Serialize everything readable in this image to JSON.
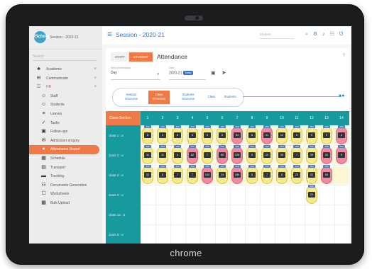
{
  "device": {
    "brand": "chrome"
  },
  "sidebar": {
    "logo": "iSchool",
    "session": "Session - 2020-21",
    "search_placeholder": "Search",
    "items": [
      {
        "label": "Academic",
        "icon": "cap-icon",
        "glyph": "♣",
        "chev": "˅"
      },
      {
        "label": "Communicate",
        "icon": "message-icon",
        "glyph": "✉",
        "chev": "˅"
      },
      {
        "label": "HR",
        "icon": "hr-icon",
        "glyph": "☰",
        "chev": "˄"
      },
      {
        "label": "Staff",
        "icon": "staff-icon",
        "glyph": "☺"
      },
      {
        "label": "Students",
        "icon": "students-icon",
        "glyph": "☺"
      },
      {
        "label": "Leaves",
        "icon": "leaves-icon",
        "glyph": "≡"
      },
      {
        "label": "Tasks",
        "icon": "tasks-icon",
        "glyph": "✓"
      },
      {
        "label": "Follow-ups",
        "icon": "followups-icon",
        "glyph": "▣"
      },
      {
        "label": "Admission enquiry",
        "icon": "enquiry-icon",
        "glyph": "✉"
      },
      {
        "label": "Attendance Report",
        "icon": "attendance-icon",
        "glyph": "●"
      },
      {
        "label": "Schedule",
        "icon": "schedule-icon",
        "glyph": "▦"
      },
      {
        "label": "Transport",
        "icon": "transport-icon",
        "glyph": "▤"
      },
      {
        "label": "Tracking",
        "icon": "tracking-icon",
        "glyph": "▬"
      },
      {
        "label": "Documents Generation",
        "icon": "documents-icon",
        "glyph": "☷"
      },
      {
        "label": "Worksheets",
        "icon": "worksheets-icon",
        "glyph": "☐"
      },
      {
        "label": "Bulk Upload",
        "icon": "upload-icon",
        "glyph": "▩"
      }
    ]
  },
  "header": {
    "session_title": "Session - 2020-21",
    "student_placeholder": "Student",
    "icons": {
      "search": "⌕",
      "settings": "⚙",
      "notify": "♪",
      "apps": "☷",
      "power": "⏻"
    }
  },
  "attendance": {
    "toggle": {
      "staff": "STAFF",
      "student": "STUDENT"
    },
    "title": "Attendance",
    "help": "?",
    "select_label": "Select Attendance",
    "select_value": "Day",
    "date_label": "Date",
    "date_value": "2020-21",
    "today_badge": "Today",
    "tabs": [
      {
        "l1": "Institute",
        "l2": "Overview"
      },
      {
        "l1": "Class",
        "l2": "Overview"
      },
      {
        "l1": "Students",
        "l2": "Overview"
      },
      {
        "l1": "Class",
        "l2": ""
      },
      {
        "l1": "Students",
        "l2": ""
      }
    ],
    "active_tab": 1,
    "grid": {
      "corner": "Class-Section",
      "columns": [
        "1",
        "2",
        "3",
        "4",
        "5",
        "6",
        "7",
        "8",
        "9",
        "10",
        "11",
        "12",
        "13",
        "14"
      ],
      "rows": [
        {
          "label": "class 1 : a",
          "cells": [
            {
              "n": "8",
              "t": "150",
              "c": "y"
            },
            {
              "n": "3",
              "t": "150",
              "c": "y"
            },
            {
              "n": "8",
              "t": "150",
              "c": "y"
            },
            {
              "n": "6",
              "t": "150",
              "c": "y"
            },
            {
              "n": "5",
              "t": "150",
              "c": "y"
            },
            {
              "n": "6",
              "t": "150",
              "c": "y"
            },
            {
              "n": "54",
              "t": "150",
              "c": "r"
            },
            {
              "n": "6",
              "t": "150",
              "c": "y"
            },
            {
              "n": "41",
              "t": "150",
              "c": "r"
            },
            {
              "n": "12",
              "t": "150",
              "c": "y"
            },
            {
              "n": "5",
              "t": "150",
              "c": "y"
            },
            {
              "n": "9",
              "t": "150",
              "c": "y"
            },
            {
              "n": "9",
              "t": "150",
              "c": "y"
            },
            {
              "n": "4",
              "t": "150",
              "c": "r"
            }
          ]
        },
        {
          "label": "class 2 : a",
          "cells": [
            {
              "n": "11",
              "t": "150",
              "c": "y"
            },
            {
              "n": "11",
              "t": "150",
              "c": "y"
            },
            {
              "n": "4",
              "t": "150",
              "c": "y"
            },
            {
              "n": "82",
              "t": "150",
              "c": "r"
            },
            {
              "n": "7",
              "t": "150",
              "c": "y"
            },
            {
              "n": "89",
              "t": "150",
              "c": "r"
            },
            {
              "n": "130",
              "t": "150",
              "c": "r"
            },
            {
              "n": "9",
              "t": "150",
              "c": "y"
            },
            {
              "n": "20",
              "t": "150",
              "c": "y"
            },
            {
              "n": "30",
              "t": "150",
              "c": "y"
            },
            {
              "n": "7",
              "t": "150",
              "c": "y"
            },
            {
              "n": "39",
              "t": "150",
              "c": "y"
            },
            {
              "n": "20",
              "t": "150",
              "c": "r"
            },
            {
              "n": "9",
              "t": "150",
              "c": "r"
            }
          ]
        },
        {
          "label": "class 3 : a",
          "cells": [
            {
              "n": "31",
              "t": "150",
              "c": "y"
            },
            {
              "n": "8",
              "t": "150",
              "c": "y"
            },
            {
              "n": "7",
              "t": "150",
              "c": "y"
            },
            {
              "n": "7",
              "t": "150",
              "c": "y"
            },
            {
              "n": "143",
              "t": "150",
              "c": "r"
            },
            {
              "n": "24",
              "t": "150",
              "c": "y"
            },
            {
              "n": "150",
              "t": "150",
              "c": "r"
            },
            {
              "n": "8",
              "t": "150",
              "c": "y"
            },
            {
              "n": "7",
              "t": "150",
              "c": "y"
            },
            {
              "n": "8",
              "t": "150",
              "c": "y"
            },
            {
              "n": "20",
              "t": "150",
              "c": "y"
            },
            {
              "n": "20",
              "t": "150",
              "c": "y"
            },
            {
              "n": "94",
              "t": "150",
              "c": "r"
            },
            {
              "n": "",
              "t": "",
              "c": ""
            }
          ]
        },
        {
          "label": "class 4 : a",
          "cells": [
            {
              "n": "",
              "t": "",
              "c": ""
            },
            {
              "n": "",
              "t": "",
              "c": ""
            },
            {
              "n": "",
              "t": "",
              "c": ""
            },
            {
              "n": "",
              "t": "",
              "c": ""
            },
            {
              "n": "",
              "t": "",
              "c": ""
            },
            {
              "n": "",
              "t": "",
              "c": ""
            },
            {
              "n": "",
              "t": "",
              "c": ""
            },
            {
              "n": "",
              "t": "",
              "c": ""
            },
            {
              "n": "",
              "t": "",
              "c": ""
            },
            {
              "n": "",
              "t": "",
              "c": ""
            },
            {
              "n": "",
              "t": "",
              "c": ""
            },
            {
              "n": "22",
              "t": "150",
              "c": "y"
            },
            {
              "n": "",
              "t": "",
              "c": ""
            },
            {
              "n": "",
              "t": "",
              "c": ""
            }
          ]
        },
        {
          "label": "class 1a : a",
          "cells": []
        },
        {
          "label": "class 5 : a",
          "cells": []
        }
      ]
    }
  }
}
